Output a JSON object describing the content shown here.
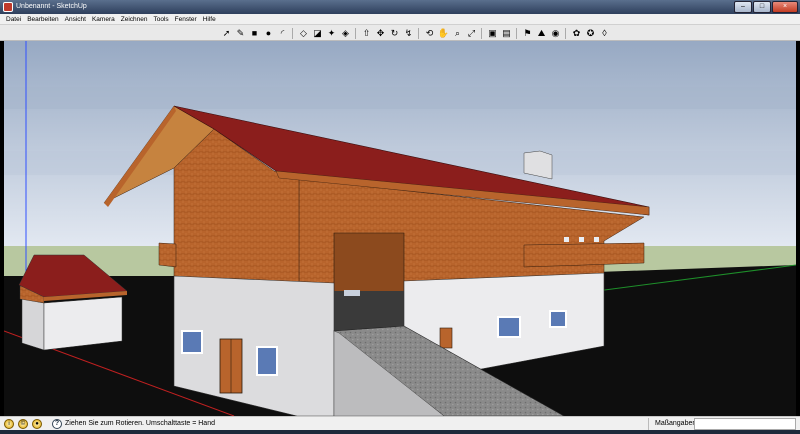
{
  "window": {
    "title": "Unbenannt - SketchUp",
    "buttons": {
      "minimize": "–",
      "maximize": "□",
      "close": "×"
    }
  },
  "menu": {
    "items": [
      "Datei",
      "Bearbeiten",
      "Ansicht",
      "Kamera",
      "Zeichnen",
      "Tools",
      "Fenster",
      "Hilfe"
    ]
  },
  "toolbar": {
    "tools": [
      {
        "name": "select-tool-icon",
        "glyph": "➚"
      },
      {
        "name": "pencil-tool-icon",
        "glyph": "✎"
      },
      {
        "name": "rectangle-tool-icon",
        "glyph": "■"
      },
      {
        "name": "circle-tool-icon",
        "glyph": "●"
      },
      {
        "name": "arc-tool-icon",
        "glyph": "◜"
      },
      {
        "name": "sep"
      },
      {
        "name": "make-component-icon",
        "glyph": "◇"
      },
      {
        "name": "eraser-tool-icon",
        "glyph": "◪"
      },
      {
        "name": "tape-measure-icon",
        "glyph": "✦"
      },
      {
        "name": "paint-bucket-icon",
        "glyph": "◈"
      },
      {
        "name": "sep"
      },
      {
        "name": "push-pull-icon",
        "glyph": "⇧"
      },
      {
        "name": "move-tool-icon",
        "glyph": "✥"
      },
      {
        "name": "rotate-tool-icon",
        "glyph": "↻"
      },
      {
        "name": "follow-me-icon",
        "glyph": "↯"
      },
      {
        "name": "sep"
      },
      {
        "name": "orbit-tool-icon",
        "glyph": "⟲"
      },
      {
        "name": "pan-tool-icon",
        "glyph": "✋"
      },
      {
        "name": "zoom-tool-icon",
        "glyph": "⌕"
      },
      {
        "name": "zoom-extents-icon",
        "glyph": "⤢"
      },
      {
        "name": "sep"
      },
      {
        "name": "get-models-icon",
        "glyph": "▣"
      },
      {
        "name": "share-model-icon",
        "glyph": "▤"
      },
      {
        "name": "sep"
      },
      {
        "name": "add-location-icon",
        "glyph": "⚑"
      },
      {
        "name": "toggle-terrain-icon",
        "glyph": "⛰"
      },
      {
        "name": "preview-earth-icon",
        "glyph": "◉"
      },
      {
        "name": "sep"
      },
      {
        "name": "component-icon",
        "glyph": "✿"
      },
      {
        "name": "extension-icon",
        "glyph": "✪"
      },
      {
        "name": "share-component-icon",
        "glyph": "◊"
      }
    ]
  },
  "status": {
    "message": "Ziehen Sie zum Rotieren.  Umschalttaste = Hand",
    "measure_label": "Maßangaben",
    "measure_value": "",
    "icons": [
      "geo-location-icon",
      "credits-icon",
      "user-icon"
    ]
  },
  "colors": {
    "roof": "#8b1e1c",
    "wood": "#b8642c",
    "wall": "#e6e6e8",
    "sky_top": "#97a9c3",
    "sky_bottom": "#dde4ee",
    "ground_strip": "#b8c8a0",
    "viewport_ground": "#0e0e0e"
  }
}
